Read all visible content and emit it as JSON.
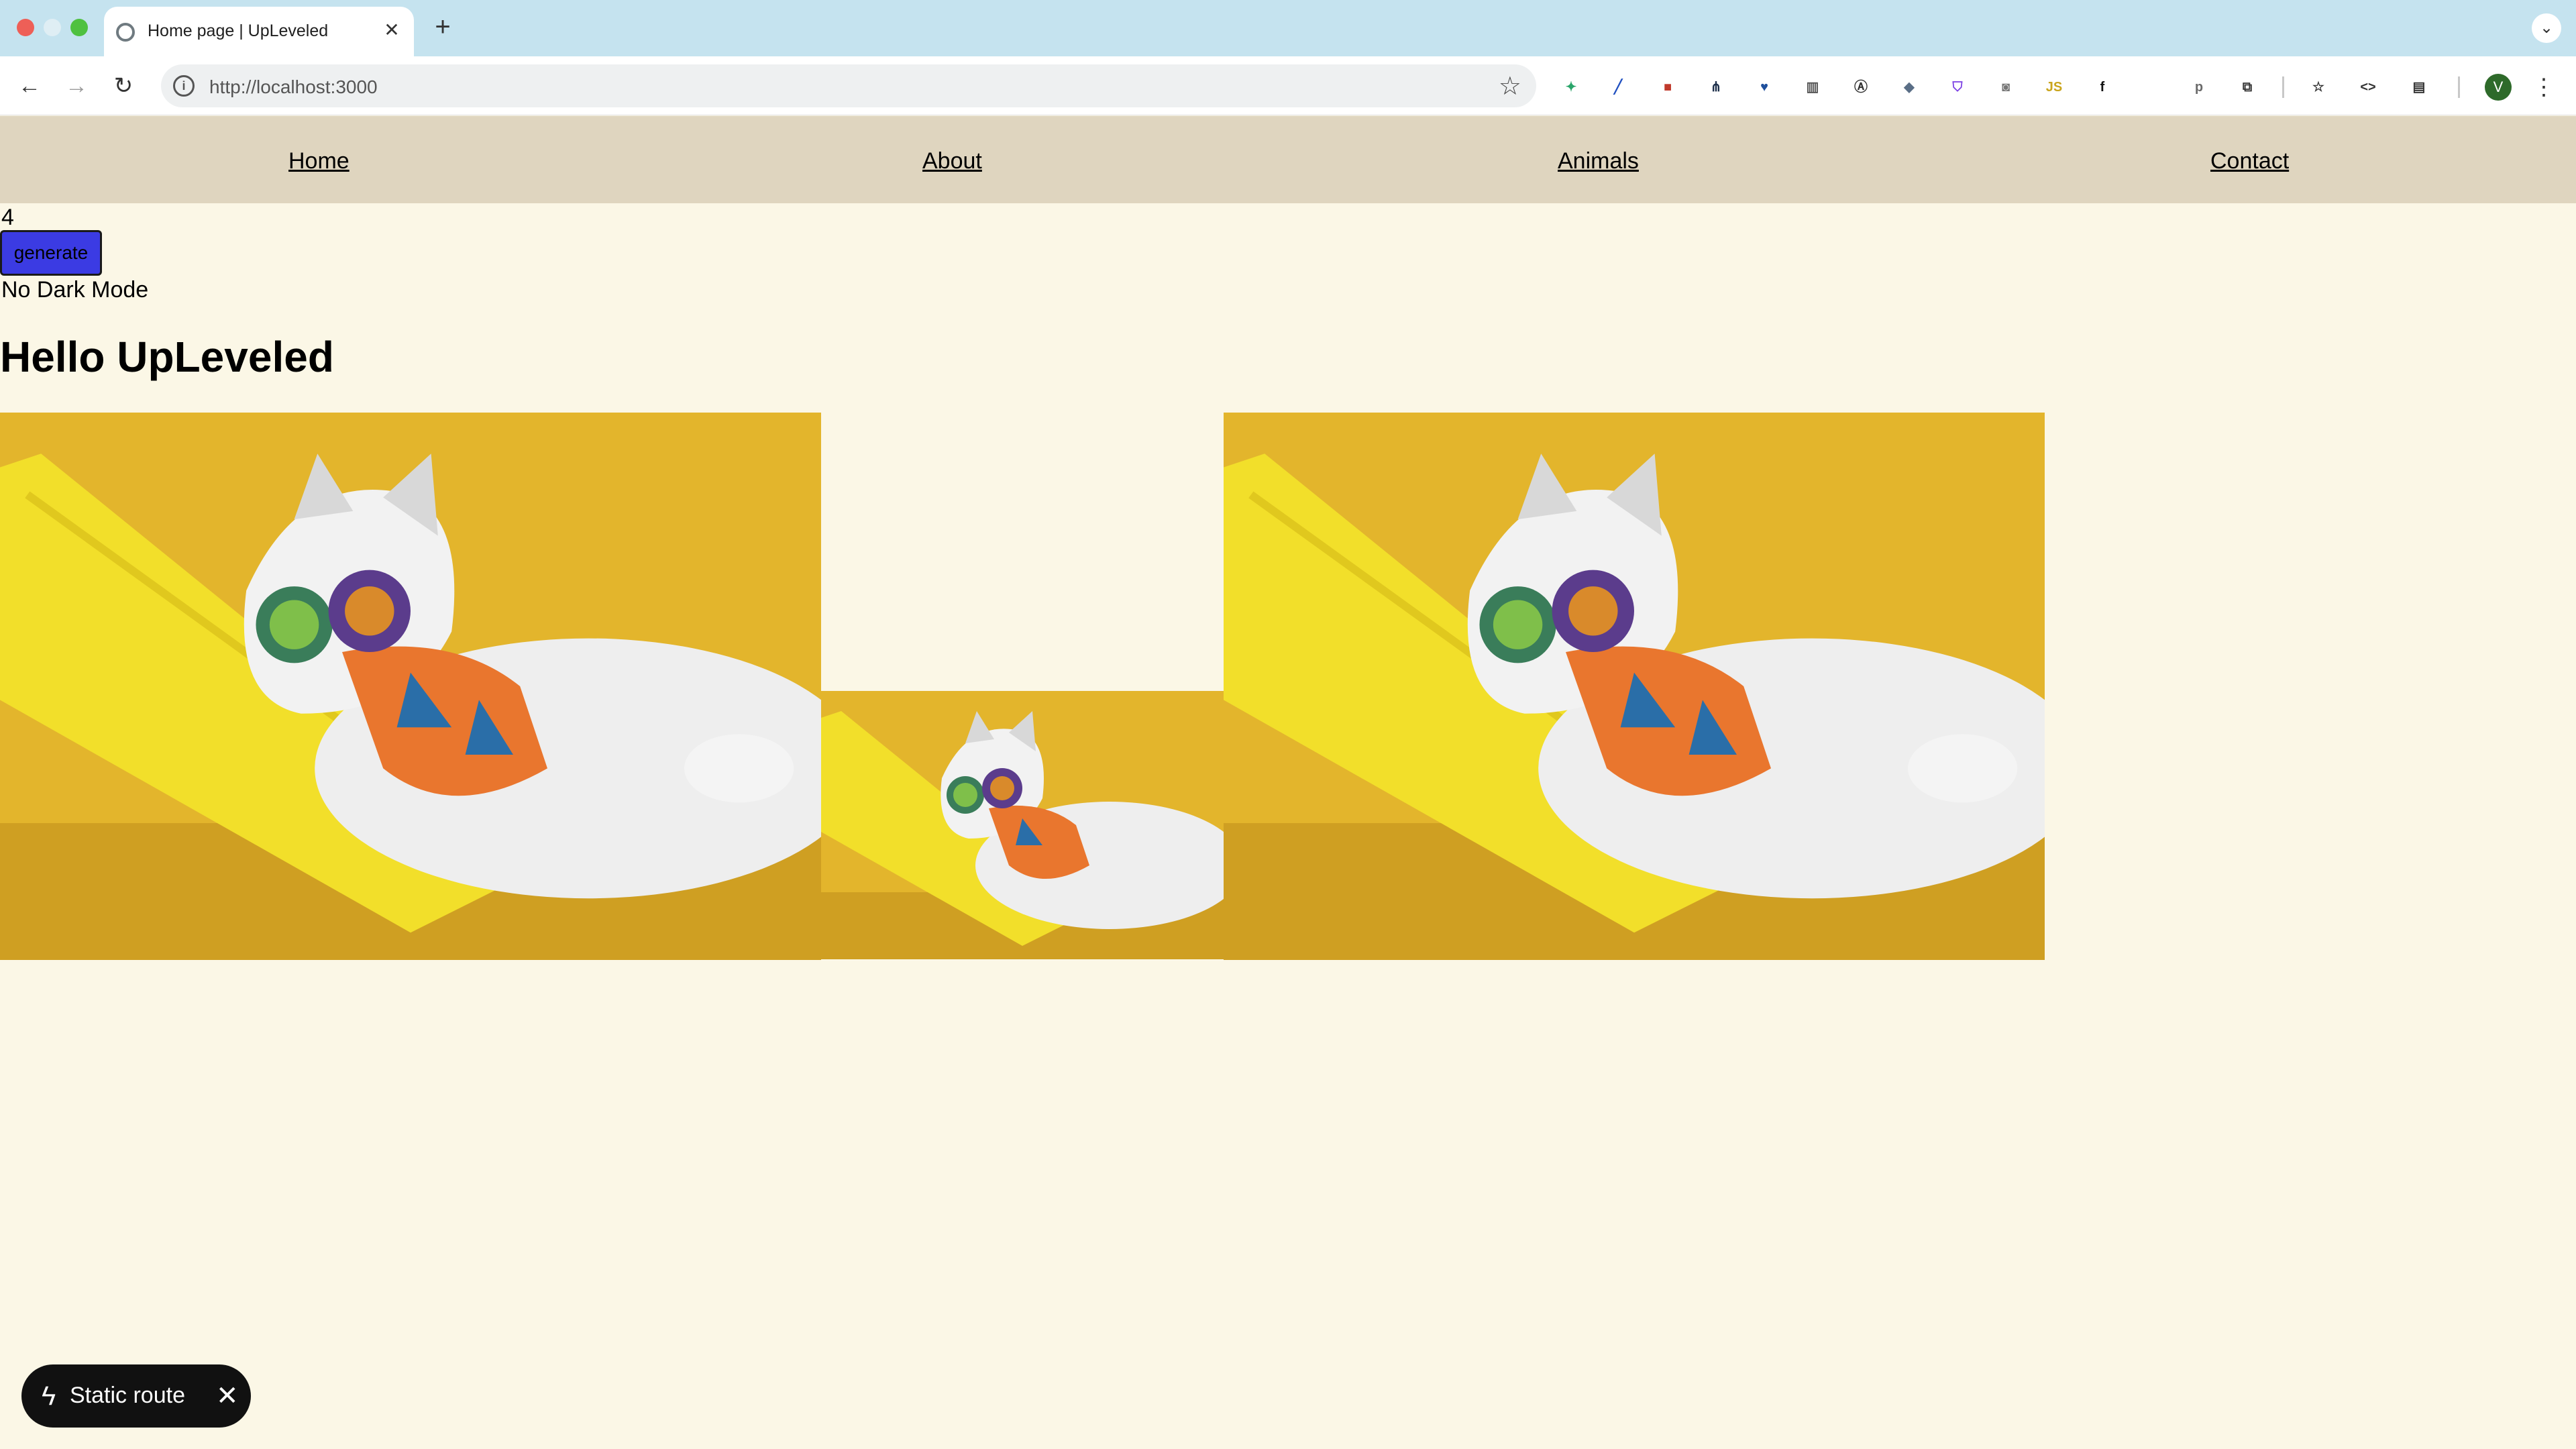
{
  "browser": {
    "tab_title": "Home page | UpLeveled",
    "tab_close": "✕",
    "new_tab": "+",
    "tab_list": "⌄",
    "url": "http://localhost:3000",
    "omni_info": "i",
    "bookmark_star": "☆",
    "back": "←",
    "forward": "→",
    "reload": "↻",
    "profile_initial": "V",
    "menu": "⋮",
    "extensions": [
      {
        "icon": "hummingbird-icon",
        "glyph": "✦",
        "color": "#2aa56a"
      },
      {
        "icon": "pen-icon",
        "glyph": "╱",
        "color": "#2050c0"
      },
      {
        "icon": "red-square-icon",
        "glyph": "■",
        "color": "#c0392b"
      },
      {
        "icon": "tree-icon",
        "glyph": "⋔",
        "color": "#1c2e4a"
      },
      {
        "icon": "heart-icon",
        "glyph": "♥",
        "color": "#1e4f9c"
      },
      {
        "icon": "building-icon",
        "glyph": "▥",
        "color": "#555555"
      },
      {
        "icon": "a-circle-icon",
        "glyph": "Ⓐ",
        "color": "#333333"
      },
      {
        "icon": "cube-icon",
        "glyph": "◆",
        "color": "#5a6e86"
      },
      {
        "icon": "shield-icon",
        "glyph": "⛉",
        "color": "#7b3fe4"
      },
      {
        "icon": "camera-icon",
        "glyph": "◙",
        "color": "#777777"
      },
      {
        "icon": "js-icon",
        "glyph": "JS",
        "color": "#caa51d"
      },
      {
        "icon": "function-icon",
        "glyph": "f",
        "color": "#111111"
      },
      {
        "icon": "p-icon",
        "glyph": "p",
        "color": "#6b6b6b"
      },
      {
        "icon": "puzzle-icon",
        "glyph": "⧉",
        "color": "#333333"
      },
      {
        "icon": "bookmarks-icon",
        "glyph": "☆",
        "color": "#333333"
      },
      {
        "icon": "code-icon",
        "glyph": "<>",
        "color": "#333333"
      },
      {
        "icon": "sidepanel-icon",
        "glyph": "▤",
        "color": "#333333"
      }
    ]
  },
  "nav": {
    "home": "Home",
    "about": "About",
    "animals": "Animals",
    "contact": "Contact"
  },
  "main": {
    "count": "4",
    "generate_label": "generate",
    "dark_mode_text": "No Dark Mode",
    "heading": "Hello UpLeveled"
  },
  "images": [
    {
      "alt": "cat with sunglasses in hammock"
    },
    {
      "alt": "cat with sunglasses in hammock"
    },
    {
      "alt": "cat with sunglasses in hammock"
    }
  ],
  "badge": {
    "bolt": "ϟ",
    "label": "Static route",
    "close": "✕"
  },
  "colors": {
    "page_bg": "#fbf7e6",
    "nav_bg": "#dfd5bf",
    "button_bg": "#3b3be3",
    "badge_bg": "#111111"
  }
}
